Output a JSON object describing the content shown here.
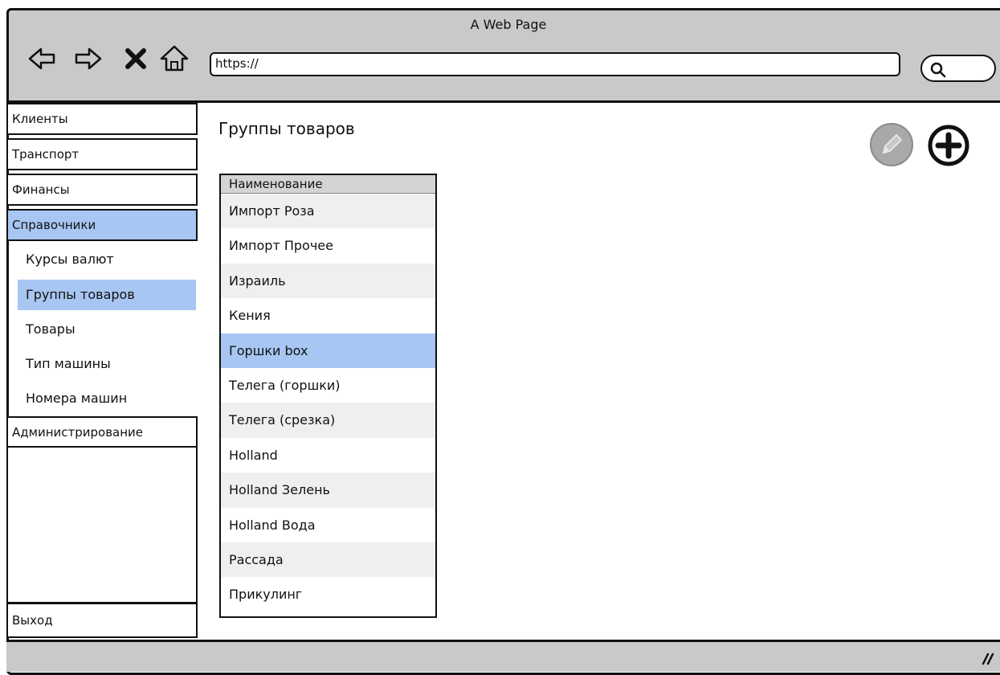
{
  "window": {
    "title": "A Web Page"
  },
  "browser": {
    "url": "https://"
  },
  "sidebar": {
    "items": [
      {
        "label": "Клиенты"
      },
      {
        "label": "Транспорт"
      },
      {
        "label": "Финансы"
      },
      {
        "label": "Справочники"
      }
    ],
    "subitems": [
      {
        "label": "Курсы валют"
      },
      {
        "label": "Группы товаров"
      },
      {
        "label": "Товары"
      },
      {
        "label": "Тип машины"
      },
      {
        "label": "Номера машин"
      }
    ],
    "admin": "Администрирование",
    "exit": "Выход"
  },
  "main": {
    "title": "Группы товаров",
    "column_header": "Наименование",
    "rows": [
      "Импорт Роза",
      "Импорт Прочее",
      "Израиль",
      "Кения",
      "Горшки box",
      "Телега (горшки)",
      "Телега (срезка)",
      "Holland",
      "Holland Зелень",
      "Holland Вода",
      "Рассада",
      "Прикулинг"
    ],
    "selected_row": "Горшки box"
  },
  "colors": {
    "selection": "#a7c6f2",
    "chrome": "#c9c9c9"
  }
}
